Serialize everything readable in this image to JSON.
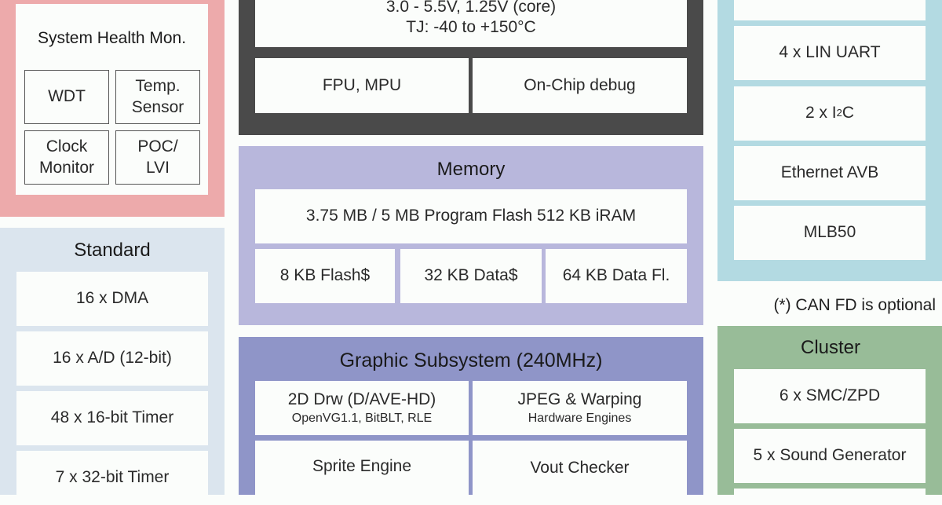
{
  "colors": {
    "safety_bg": "#edaaab",
    "standard_bg": "#dbe5ee",
    "cpu_bg": "#4a4a4a",
    "memory_bg": "#b8b7dc",
    "graphic_bg": "#8f95c8",
    "comm_bg": "#b3dae2",
    "cluster_bg": "#98bc98",
    "cell_bg": "#fbfdfb"
  },
  "safety": {
    "title": "System Health Mon.",
    "items": [
      {
        "line1": "WDT",
        "line2": ""
      },
      {
        "line1": "Temp.",
        "line2": "Sensor"
      },
      {
        "line1": "Clock",
        "line2": "Monitor"
      },
      {
        "line1": "POC/",
        "line2": "LVI"
      }
    ]
  },
  "standard": {
    "title": "Standard",
    "items": [
      "16 x DMA",
      "16 x A/D (12-bit)",
      "48 x 16-bit Timer",
      "7 x 32-bit Timer"
    ]
  },
  "cpu": {
    "spec_line1": "3.0 - 5.5V, 1.25V (core)",
    "spec_line2": "TJ: -40 to +150°C",
    "items": [
      "FPU, MPU",
      "On-Chip debug"
    ]
  },
  "memory": {
    "title": "Memory",
    "main": "3.75 MB / 5 MB Program Flash 512 KB iRAM",
    "items": [
      "8 KB Flash$",
      "32 KB Data$",
      "64 KB Data Fl."
    ]
  },
  "graphic": {
    "title": "Graphic Subsystem (240MHz)",
    "items": [
      {
        "main": "2D Drw (D/AVE-HD)",
        "sub": "OpenVG1.1, BitBLT, RLE"
      },
      {
        "main": "JPEG & Warping",
        "sub": "Hardware Engines"
      },
      {
        "main": "Sprite Engine",
        "sub": ""
      },
      {
        "main": "Vout Checker",
        "sub": ""
      }
    ]
  },
  "comm": {
    "items": [
      "",
      "4 x LIN UART",
      "2 x I",
      "Ethernet AVB",
      "MLB50"
    ],
    "i2c_sup": "2",
    "i2c_tail": "C"
  },
  "note": "(*) CAN FD is optional",
  "cluster": {
    "title": "Cluster",
    "items": [
      "6 x SMC/ZPD",
      "5 x Sound Generator"
    ]
  }
}
